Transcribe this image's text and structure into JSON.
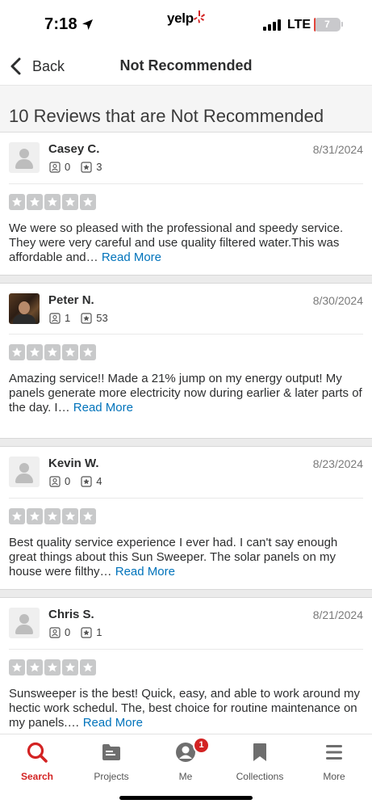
{
  "status_bar": {
    "time": "7:18",
    "carrier_logo": "yelp",
    "network": "LTE",
    "battery_level": "7",
    "battery_fraction": 0.07,
    "signal_bars": 4
  },
  "nav": {
    "back_label": "Back",
    "title": "Not Recommended"
  },
  "section": {
    "title": "10 Reviews that are Not Recommended"
  },
  "reviews": [
    {
      "name": "Casey C.",
      "date": "8/31/2024",
      "friends": "0",
      "review_count": "3",
      "rating": 0,
      "avatar": "default-avatar",
      "text": "We were so pleased with the professional and speedy service. They were very careful and use quality filtered water.This was affordable and…",
      "read_more": "Read More"
    },
    {
      "name": "Peter N.",
      "date": "8/30/2024",
      "friends": "1",
      "review_count": "53",
      "rating": 0,
      "avatar": "user-photo",
      "text": "Amazing service!! Made a 21% jump on my energy output! My panels generate more electricity now during earlier & later parts of the day. I…",
      "read_more": "Read More"
    },
    {
      "name": "Kevin W.",
      "date": "8/23/2024",
      "friends": "0",
      "review_count": "4",
      "rating": 0,
      "avatar": "default-avatar",
      "text": "Best quality service experience I ever had. I can't say enough great things about this Sun Sweeper. The solar panels on my house were filthy…",
      "read_more": "Read More"
    },
    {
      "name": "Chris S.",
      "date": "8/21/2024",
      "friends": "0",
      "review_count": "1",
      "rating": 0,
      "avatar": "default-avatar",
      "text": "Sunsweeper is the best! Quick, easy, and able to work around my hectic work schedul. The, best choice for routine maintenance on my panels.…",
      "read_more": "Read More"
    }
  ],
  "tabbar": {
    "tabs": [
      {
        "label": "Search",
        "icon": "search-icon",
        "active": true
      },
      {
        "label": "Projects",
        "icon": "projects-icon",
        "active": false
      },
      {
        "label": "Me",
        "icon": "profile-icon",
        "active": false,
        "badge": "1"
      },
      {
        "label": "Collections",
        "icon": "bookmark-icon",
        "active": false
      },
      {
        "label": "More",
        "icon": "menu-icon",
        "active": false
      }
    ]
  },
  "colors": {
    "accent_red": "#d32323",
    "link_blue": "#0073bb",
    "star_gray": "#c8c9ca"
  }
}
